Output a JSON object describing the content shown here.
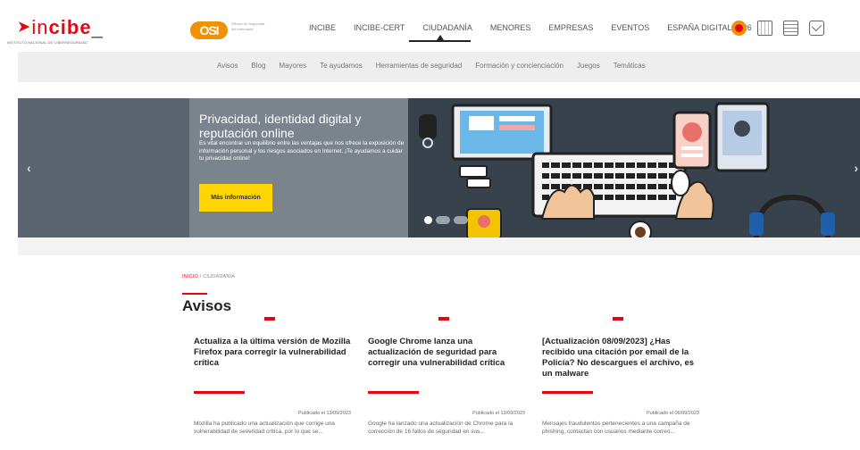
{
  "header": {
    "logo": {
      "mark": "incibe",
      "tagline": "INSTITUTO NACIONAL DE CIBERSEGURIDAD"
    },
    "osi": {
      "badge": "OSI",
      "text": "Oficina de Seguridad del Internauta"
    },
    "nav": [
      {
        "label": "INCIBE"
      },
      {
        "label": "INCIBE-CERT"
      },
      {
        "label": "CIUDADANÍA",
        "active": true
      },
      {
        "label": "MENORES"
      },
      {
        "label": "EMPRESAS"
      },
      {
        "label": "EVENTOS"
      },
      {
        "label": "ESPAÑA DIGITAL 2026"
      }
    ],
    "icons": [
      "017-icon",
      "calendar-icon",
      "document-icon",
      "mail-icon"
    ]
  },
  "subnav": [
    "Avisos",
    "Blog",
    "Mayores",
    "Te ayudamos",
    "Herramientas de seguridad",
    "Formación y concienciación",
    "Juegos",
    "Temáticas"
  ],
  "banner": {
    "title": "Privacidad, identidad digital y reputación online",
    "description": "Es vital encontrar un equilibrio entre las ventajas que nos ofrece la exposición de información personal y los riesgos asociados en Internet. ¡Te ayudamos a cuidar tu privacidad online!",
    "button": "Más información",
    "prev": "‹",
    "next": "›"
  },
  "breadcrumb": {
    "home": "INICIO",
    "separator": "/",
    "current": "CIUDADANÍA"
  },
  "section_title": "Avisos",
  "cards": [
    {
      "title": "Actualiza a la última versión de Mozilla Firefox para corregir la vulnerabilidad crítica",
      "date": "Publicado el 13/09/2023",
      "text": "Mozilla ha publicado una actualización que corrige una vulnerabilidad de severidad crítica, por lo que se..."
    },
    {
      "title": "Google Chrome lanza una actualización de seguridad para corregir una vulnerabilidad crítica",
      "date": "Publicado el 13/09/2023",
      "text": "Google ha lanzado una actualización de Chrome para la corrección de 16 fallos de seguridad en sus..."
    },
    {
      "title": "[Actualización 08/09/2023] ¿Has recibido una citación por email de la Policía? No descargues el archivo, es un malware",
      "date": "Publicado el 06/09/2023",
      "text": "Mensajes fraudulentos pertenecientes a una campaña de phishing, contactan con usuarios mediante correo..."
    }
  ],
  "colors": {
    "accent": "#e30613",
    "button": "#ffd500",
    "osi": "#f29100"
  }
}
